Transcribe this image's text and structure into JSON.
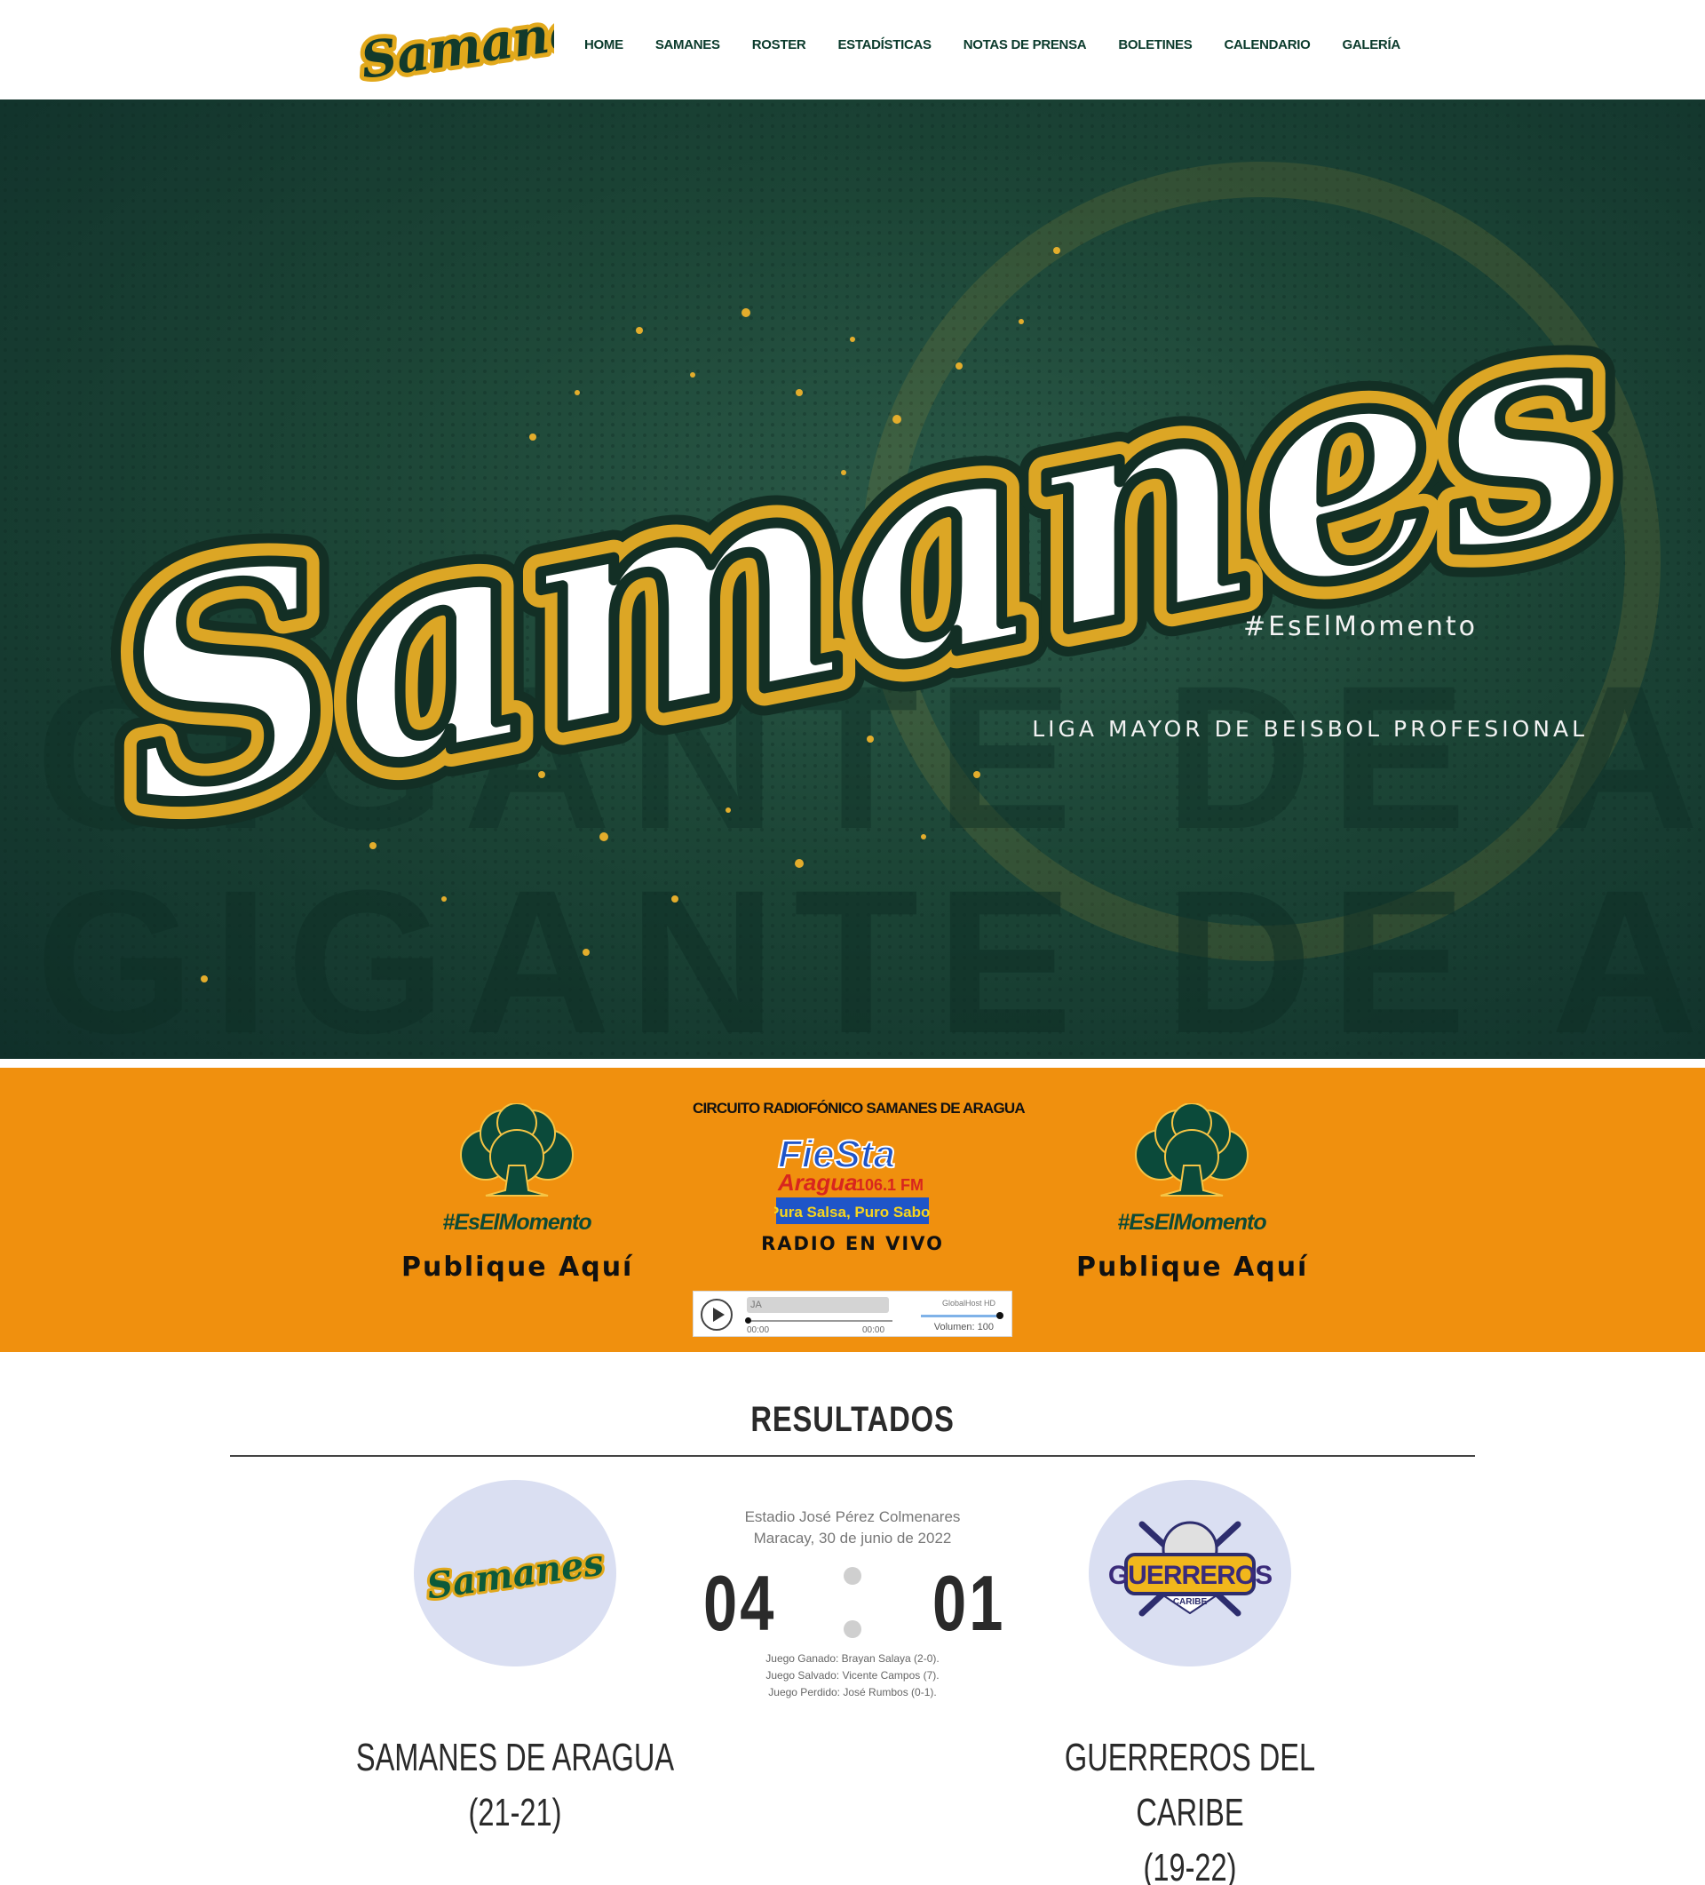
{
  "header": {
    "logo_text": "Samanes",
    "nav": [
      {
        "label": "HOME"
      },
      {
        "label": "SAMANES"
      },
      {
        "label": "ROSTER"
      },
      {
        "label": "ESTADÍSTICAS"
      },
      {
        "label": "NOTAS DE PRENSA"
      },
      {
        "label": "BOLETINES"
      },
      {
        "label": "CALENDARIO"
      },
      {
        "label": "GALERÍA"
      }
    ]
  },
  "hero": {
    "wordmark": "Samanes",
    "tagline": "#EsElMomento",
    "league": "LIGA MAYOR DE BEISBOL PROFESIONAL",
    "background_text": "GIGANTE DE ARAGUA"
  },
  "band": {
    "color": "#f0900e",
    "ad_left": {
      "hashtag": "#EsElMomento",
      "cta": "Publique Aquí"
    },
    "ad_right": {
      "hashtag": "#EsElMomento",
      "cta": "Publique Aquí"
    },
    "radio": {
      "title": "CIRCUITO RADIOFÓNICO SAMANES DE ARAGUA",
      "station_name": "FieSta",
      "station_city": "Aragua",
      "station_freq": "106.1 FM",
      "station_slogan": "Pura Salsa, Puro Sabor",
      "live_label": "RADIO EN VIVO",
      "player": {
        "track_text": "JA",
        "time_elapsed": "00:00",
        "time_total": "00:00",
        "host": "GlobalHost HD",
        "volume_label": "Volumen: 100",
        "progress": 0,
        "volume": 100
      }
    }
  },
  "results": {
    "title": "RESULTADOS",
    "venue": "Estadio José Pérez Colmenares",
    "date": "Maracay, 30 de junio de 2022",
    "home": {
      "logo_text": "Samanes",
      "name": "SAMANES DE ARAGUA",
      "record": "(21-21)",
      "score": "04"
    },
    "away": {
      "logo_text": "GUERREROS",
      "logo_subtext": "CARIBE",
      "name": "GUERREROS DEL CARIBE",
      "record": "(19-22)",
      "score": "01"
    },
    "pitchers": {
      "won": "Juego Ganado: Brayan Salaya (2-0).",
      "saved": "Juego Salvado: Vicente Campos (7).",
      "lost": "Juego Perdido: José Rumbos (0-1)."
    }
  },
  "colors": {
    "brand_green": "#0b3b2c",
    "brand_gold": "#e2a91c",
    "band_orange": "#f0900e"
  }
}
